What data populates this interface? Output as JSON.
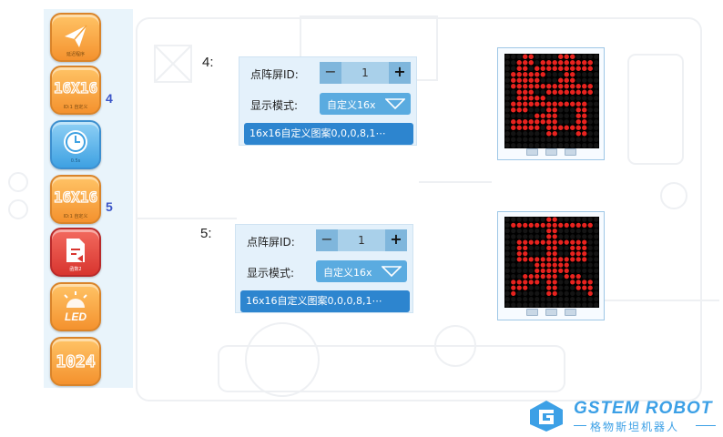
{
  "palette": {
    "blocks": [
      {
        "icon": "send-icon",
        "sub": "延迟程序",
        "color": "orange"
      },
      {
        "icon": "matrix-16x16-icon",
        "sub": "ID:1 自定义",
        "color": "orange"
      },
      {
        "icon": "clock-icon",
        "sub": "0.5s",
        "color": "blue"
      },
      {
        "icon": "matrix-16x16-icon",
        "sub": "ID:1 自定义",
        "color": "orange"
      },
      {
        "icon": "document-share-icon",
        "sub": "函数2",
        "color": "red"
      },
      {
        "icon": "led-icon",
        "sub": "",
        "color": "orange"
      },
      {
        "icon": "number-1024-icon",
        "sub": "",
        "color": "orange"
      }
    ],
    "tag_4": "4",
    "tag_5": "5"
  },
  "step4": {
    "label": "4:",
    "id_label": "点阵屏ID:",
    "id_value": "1",
    "minus": "−",
    "plus": "+",
    "mode_label": "显示模式:",
    "mode_value": "自定义16x",
    "pattern": "16x16自定义图案0,0,0,8,1⋯"
  },
  "step5": {
    "label": "5:",
    "id_label": "点阵屏ID:",
    "id_value": "1",
    "minus": "−",
    "plus": "+",
    "mode_label": "显示模式:",
    "mode_value": "自定义16x",
    "pattern": "16x16自定义图案0,0,0,8,1⋯"
  },
  "preview4": {
    "glyph": "结",
    "on_color": "#e8231f",
    "off_color": "#141414"
  },
  "preview5": {
    "glyph": "束",
    "on_color": "#e8231f",
    "off_color": "#141414"
  },
  "logo": {
    "brand": "GSTEM ROBOT",
    "cn": "格物斯坦机器人",
    "color": "#3ca0e6"
  }
}
